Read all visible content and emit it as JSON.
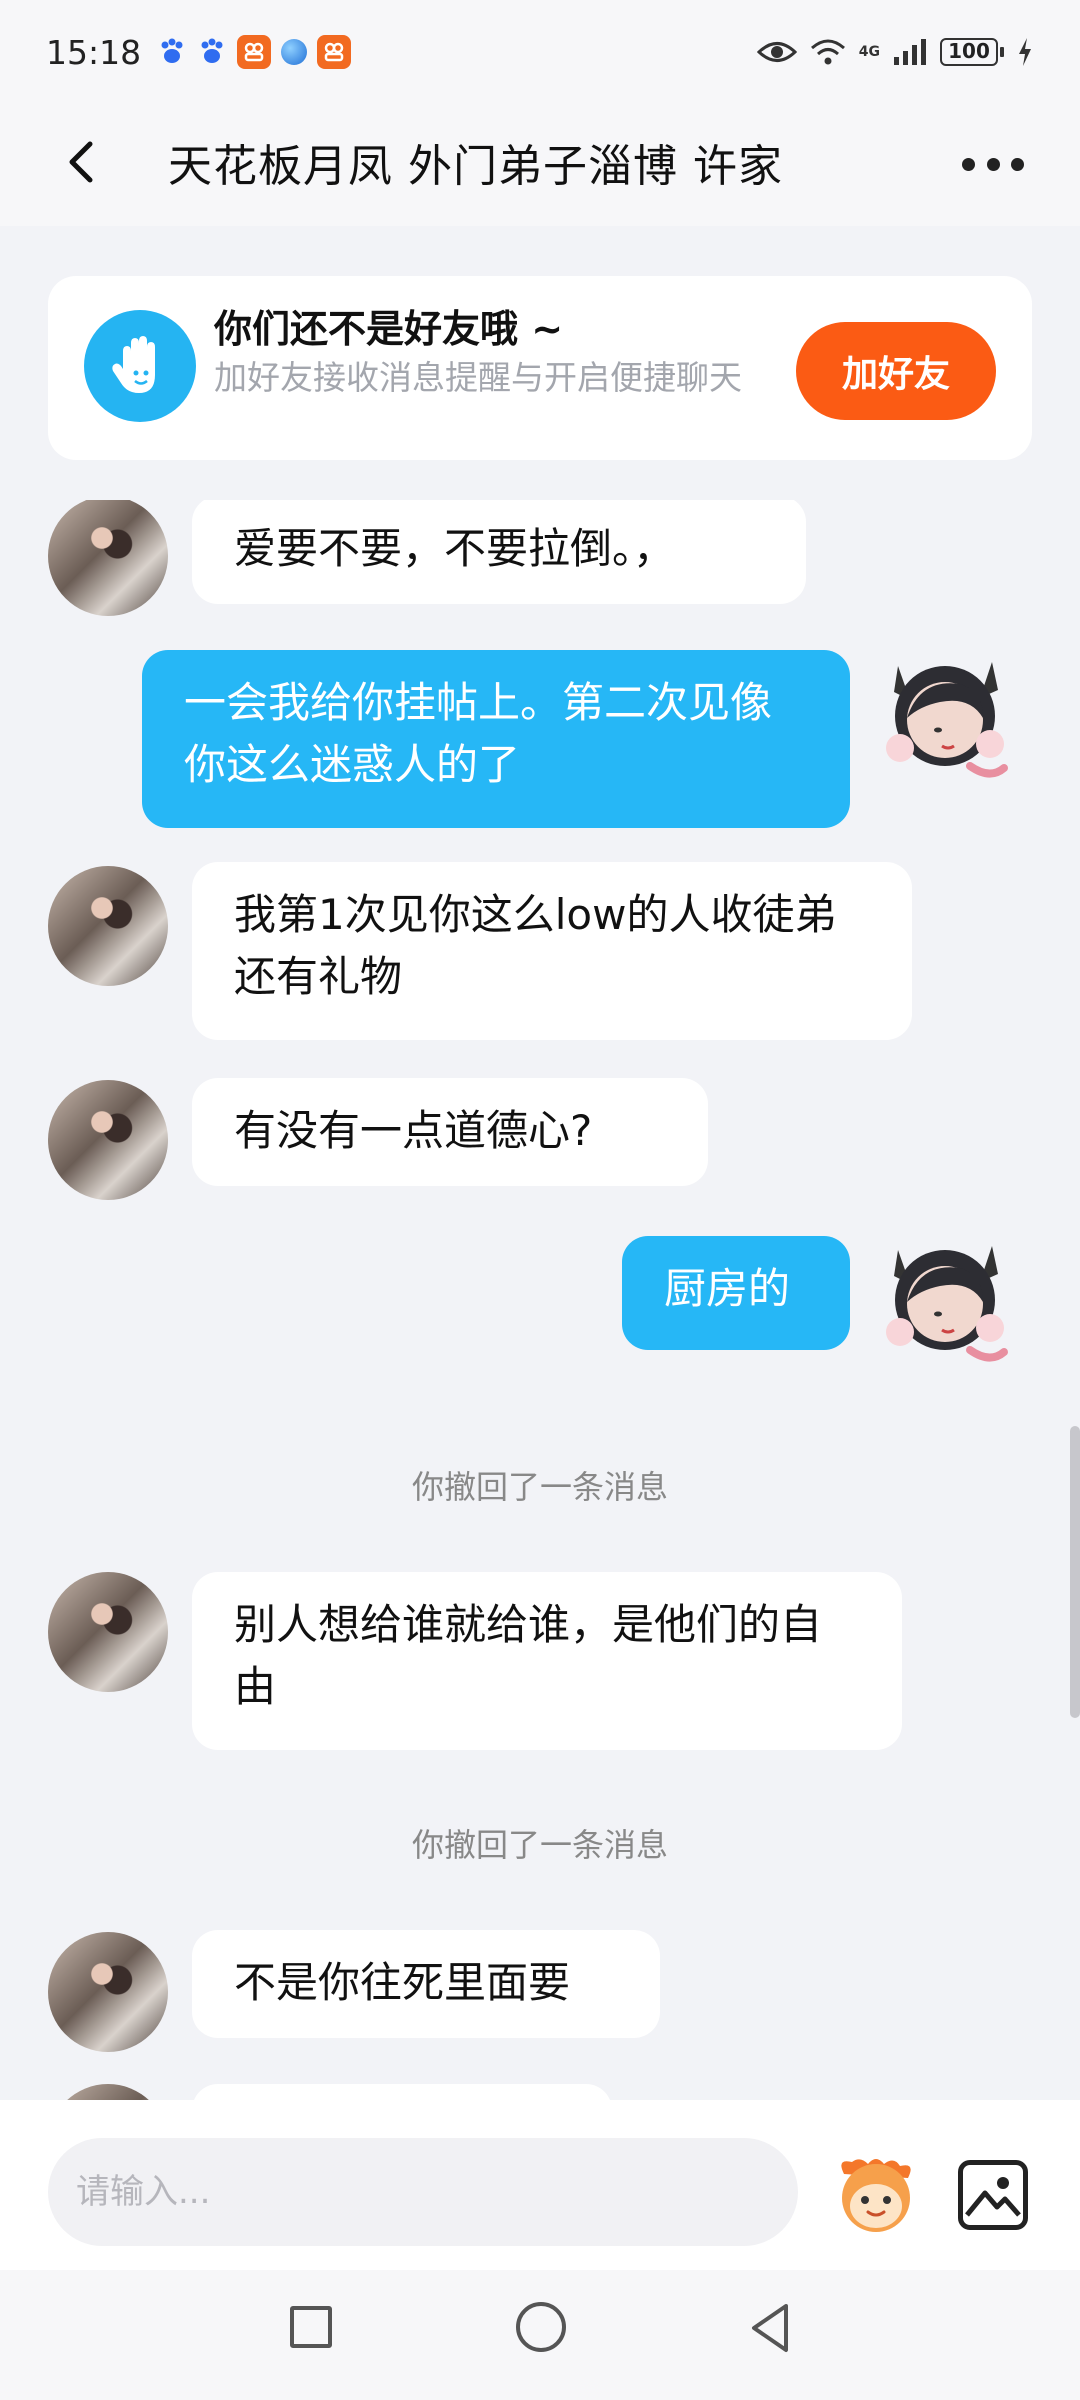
{
  "status_bar": {
    "time": "15:18",
    "battery": "100",
    "network": "4G"
  },
  "header": {
    "title": "天花板月凤  外门弟子淄博 许家"
  },
  "friend_banner": {
    "title": "你们还不是好友哦 ~",
    "subtitle": "加好友接收消息提醒与开启便捷聊天",
    "button_label": "加好友"
  },
  "messages": [
    {
      "direction": "in",
      "text": "爱要不要，不要拉倒。，"
    },
    {
      "direction": "out",
      "text": "一会我给你挂帖上。第二次见像你这么迷惑人的了"
    },
    {
      "direction": "in",
      "text": "我第1次见你这么low的人收徒弟还有礼物"
    },
    {
      "direction": "in",
      "text": "有没有一点道德心?"
    },
    {
      "direction": "out",
      "text": "厨房的"
    },
    {
      "direction": "system",
      "text": "你撤回了一条消息"
    },
    {
      "direction": "in",
      "text": "别人想给谁就给谁，是他们的自由"
    },
    {
      "direction": "system",
      "text": "你撤回了一条消息"
    },
    {
      "direction": "in",
      "text": "不是你往死里面要"
    }
  ],
  "input": {
    "placeholder": "请输入..."
  },
  "colors": {
    "accent_blue": "#26b7f6",
    "add_friend_orange": "#fb5b14",
    "background": "#f2f3f7"
  }
}
